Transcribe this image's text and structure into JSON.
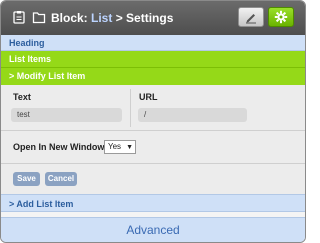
{
  "titlebar": {
    "title_prefix": "Block: ",
    "title_link": "List",
    "title_suffix": " > Settings"
  },
  "sections": {
    "heading": "Heading",
    "list_items": "List Items",
    "modify_item": "> Modify List Item",
    "add_item": "> Add List Item",
    "advanced": "Advanced"
  },
  "form": {
    "text_label": "Text",
    "text_value": "test",
    "url_label": "URL",
    "url_value": "/",
    "new_window_label": "Open In New Window",
    "new_window_value": "Yes",
    "save_label": "Save",
    "cancel_label": "Cancel"
  },
  "colors": {
    "accent_green": "#95d918",
    "accent_blue": "#cfe0f7",
    "link_text": "#2c5e9e"
  }
}
